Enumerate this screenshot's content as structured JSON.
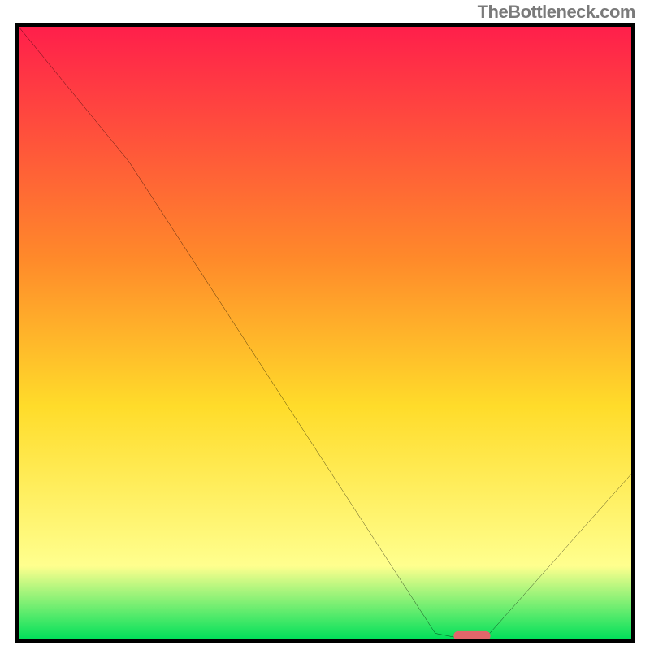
{
  "watermark": "TheBottleneck.com",
  "chart_data": {
    "type": "line",
    "title": "",
    "xlabel": "",
    "ylabel": "",
    "xlim": [
      0,
      100
    ],
    "ylim": [
      0,
      100
    ],
    "gradient": {
      "top": "#ff1f4b",
      "upper_mid": "#ff8a2a",
      "mid": "#ffdc2a",
      "lower_mid": "#ffff8e",
      "bottom": "#00e05a"
    },
    "series": [
      {
        "name": "bottleneck-curve",
        "x": [
          0,
          18,
          68,
          73,
          76,
          100
        ],
        "y": [
          100,
          78,
          1,
          0,
          0,
          27
        ]
      }
    ],
    "marker": {
      "name": "optimal-range",
      "x": 74,
      "y": 0.6,
      "width": 6,
      "height": 1.5,
      "color": "#e2666a"
    }
  }
}
